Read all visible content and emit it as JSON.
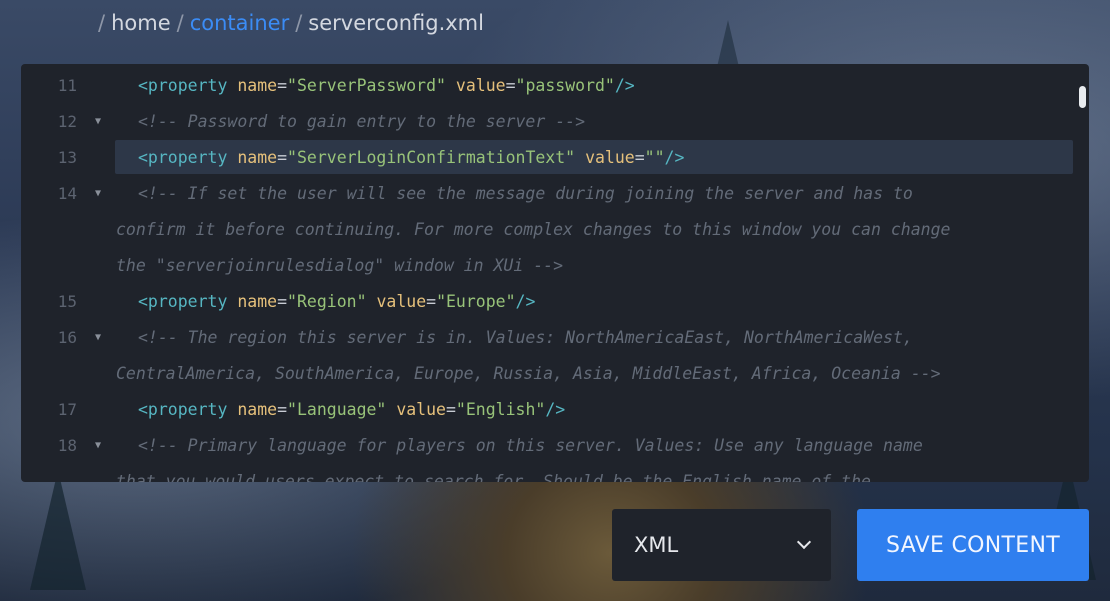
{
  "breadcrumb": {
    "sep1": "/",
    "home": "home",
    "sep2": "/",
    "container": "container",
    "sep3": "/",
    "file": "serverconfig.xml"
  },
  "editor": {
    "lines": [
      {
        "num": "11",
        "fold": "",
        "segments": [
          {
            "t": "tag",
            "v": "<property "
          },
          {
            "t": "attr",
            "v": "name"
          },
          {
            "t": "eq",
            "v": "="
          },
          {
            "t": "str",
            "v": "\"ServerPassword\""
          },
          {
            "t": "eq",
            "v": " "
          },
          {
            "t": "attr",
            "v": "value"
          },
          {
            "t": "eq",
            "v": "="
          },
          {
            "t": "str",
            "v": "\"password\""
          },
          {
            "t": "tag",
            "v": "/>"
          }
        ]
      },
      {
        "num": "12",
        "fold": "▼",
        "segments": [
          {
            "t": "cmt",
            "v": "<!-- Password to gain entry to the server -->"
          }
        ]
      },
      {
        "num": "13",
        "fold": "",
        "highlight": true,
        "segments": [
          {
            "t": "tag",
            "v": "<property "
          },
          {
            "t": "attr",
            "v": "name"
          },
          {
            "t": "eq",
            "v": "="
          },
          {
            "t": "str",
            "v": "\"ServerLoginConfirmationText\""
          },
          {
            "t": "eq",
            "v": " "
          },
          {
            "t": "attr",
            "v": "value"
          },
          {
            "t": "eq",
            "v": "="
          },
          {
            "t": "str",
            "v": "\"\""
          },
          {
            "t": "tag",
            "v": "/>"
          }
        ]
      },
      {
        "num": "14",
        "fold": "▼",
        "segments": [
          {
            "t": "cmt",
            "v": "<!-- If set the user will see the message during joining the server and has to"
          }
        ]
      },
      {
        "num": "",
        "fold": "",
        "wrap": true,
        "segments": [
          {
            "t": "cmt",
            "v": "confirm it before continuing. For more complex changes to this window you can change"
          }
        ]
      },
      {
        "num": "",
        "fold": "",
        "wrap": true,
        "segments": [
          {
            "t": "cmt",
            "v": "the \"serverjoinrulesdialog\" window in XUi -->"
          }
        ]
      },
      {
        "num": "15",
        "fold": "",
        "segments": [
          {
            "t": "tag",
            "v": "<property "
          },
          {
            "t": "attr",
            "v": "name"
          },
          {
            "t": "eq",
            "v": "="
          },
          {
            "t": "str",
            "v": "\"Region\""
          },
          {
            "t": "eq",
            "v": " "
          },
          {
            "t": "attr",
            "v": "value"
          },
          {
            "t": "eq",
            "v": "="
          },
          {
            "t": "str",
            "v": "\"Europe\""
          },
          {
            "t": "tag",
            "v": "/>"
          }
        ]
      },
      {
        "num": "16",
        "fold": "▼",
        "segments": [
          {
            "t": "cmt",
            "v": "<!-- The region this server is in. Values: NorthAmericaEast, NorthAmericaWest,"
          }
        ]
      },
      {
        "num": "",
        "fold": "",
        "wrap": true,
        "segments": [
          {
            "t": "cmt",
            "v": "CentralAmerica, SouthAmerica, Europe, Russia, Asia, MiddleEast, Africa, Oceania -->"
          }
        ]
      },
      {
        "num": "17",
        "fold": "",
        "segments": [
          {
            "t": "tag",
            "v": "<property "
          },
          {
            "t": "attr",
            "v": "name"
          },
          {
            "t": "eq",
            "v": "="
          },
          {
            "t": "str",
            "v": "\"Language\""
          },
          {
            "t": "eq",
            "v": " "
          },
          {
            "t": "attr",
            "v": "value"
          },
          {
            "t": "eq",
            "v": "="
          },
          {
            "t": "str",
            "v": "\"English\""
          },
          {
            "t": "tag",
            "v": "/>"
          }
        ]
      },
      {
        "num": "18",
        "fold": "▼",
        "segments": [
          {
            "t": "cmt",
            "v": "<!-- Primary language for players on this server. Values: Use any language name"
          }
        ]
      },
      {
        "num": "",
        "fold": "",
        "wrap": true,
        "segments": [
          {
            "t": "cmt",
            "v": "that you would users expect to search for. Should be the English name of the"
          }
        ]
      }
    ]
  },
  "syntax_colors": {
    "tag": "#56b6c2",
    "attr": "#e5c07b",
    "string": "#98c379",
    "comment": "#636b78"
  },
  "language_select": {
    "value": "XML",
    "icon": "chevron-down-icon"
  },
  "save_button": {
    "label": "SAVE CONTENT",
    "color": "#2f7fef"
  }
}
